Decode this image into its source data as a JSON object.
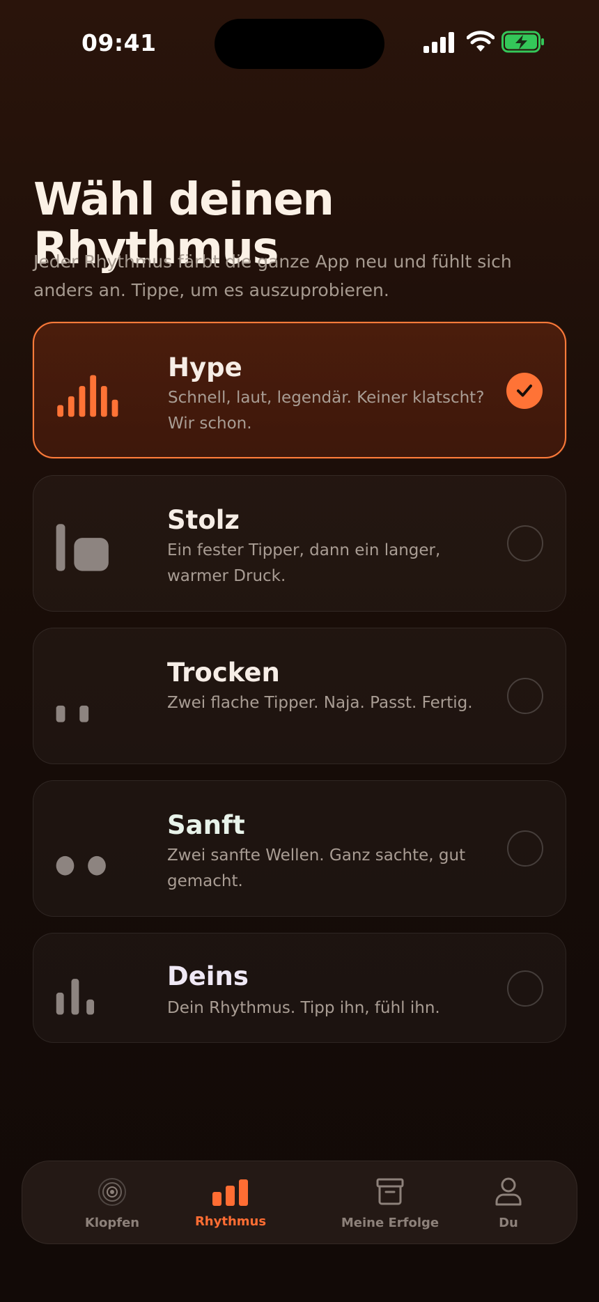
{
  "status_bar": {
    "time": "09:41"
  },
  "header": {
    "title": "Wähl deinen Rhythmus",
    "subtitle": "Jeder Rhythmus färbt die ganze App neu und fühlt sich anders an. Tippe, um es auszuprobieren."
  },
  "options": [
    {
      "title": "Hype",
      "description": "Schnell, laut, legendär. Keiner klatscht? Wir schon.",
      "selected": true,
      "icon": "bars-pulse-icon"
    },
    {
      "title": "Stolz",
      "description": "Ein fester Tipper, dann ein langer, warmer Druck.",
      "selected": false,
      "icon": "tap-press-icon"
    },
    {
      "title": "Trocken",
      "description": "Zwei flache Tipper. Naja. Passt. Fertig.",
      "selected": false,
      "icon": "double-tick-icon"
    },
    {
      "title": "Sanft",
      "description": "Zwei sanfte Wellen. Ganz sachte, gut gemacht.",
      "selected": false,
      "icon": "two-dots-icon"
    },
    {
      "title": "Deins",
      "description": "Dein Rhythmus. Tipp ihn, fühl ihn.",
      "selected": false,
      "icon": "custom-bars-icon"
    }
  ],
  "tabs": [
    {
      "label": "Klopfen",
      "icon": "target-icon",
      "active": false
    },
    {
      "label": "Rhythmus",
      "icon": "bars-icon",
      "active": true
    },
    {
      "label": "Meine Erfolge",
      "icon": "archive-box-icon",
      "active": false
    },
    {
      "label": "Du",
      "icon": "person-icon",
      "active": false
    }
  ],
  "colors": {
    "accent": "#ff7336",
    "background": "#1a0e09",
    "title_text": "#fbf1e6",
    "muted_text": "#a69a90",
    "battery_green": "#34c759"
  }
}
